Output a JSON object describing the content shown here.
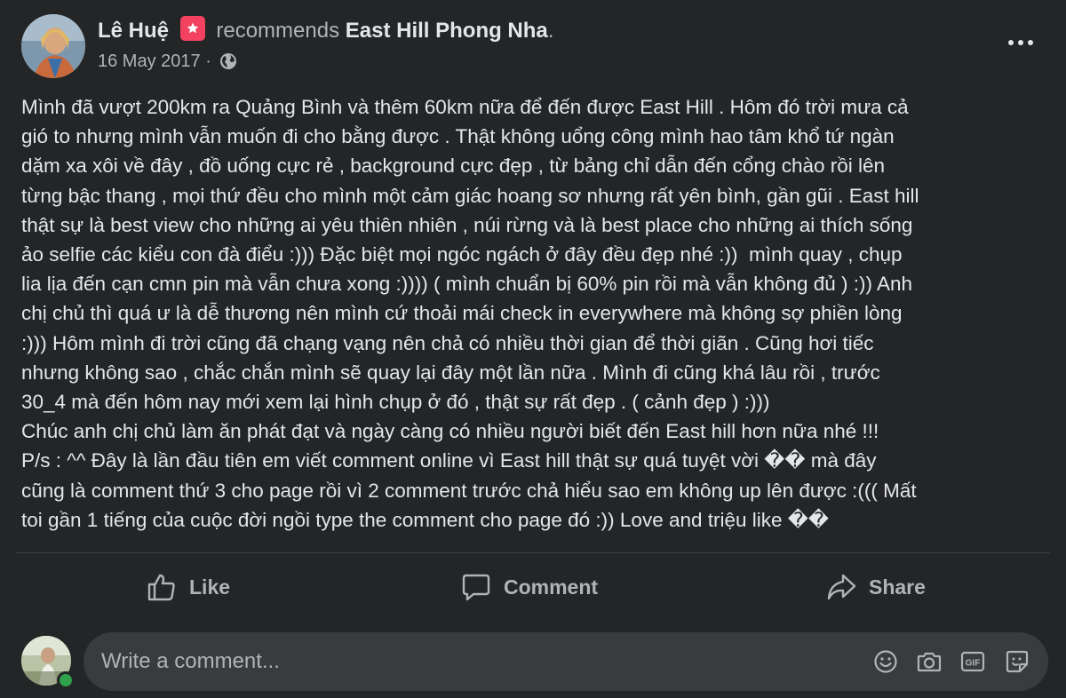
{
  "post": {
    "author": "Lê Huệ",
    "verb": "recommends",
    "page_name": "East Hill Phong Nha",
    "page_suffix": ".",
    "date": "16 May 2017",
    "date_separator": "·",
    "text": "Mình đã vượt 200km ra Quảng Bình và thêm 60km nữa để đến được East Hill . Hôm đó trời mưa cả\ngió to nhưng mình vẫn muốn đi cho bằng được . Thật không uổng công mình hao tâm khổ tứ ngàn\ndặm xa xôi về đây , đồ uống cực rẻ , background cực đẹp , từ bảng chỉ dẫn đến cổng chào rồi lên\ntừng bậc thang , mọi thứ đều cho mình một cảm giác hoang sơ nhưng rất yên bình, gần gũi . East hill\nthật sự là best view cho những ai yêu thiên nhiên , núi rừng và là best place cho những ai thích sống\nảo selfie các kiểu con đà điểu :))) Đặc biệt mọi ngóc ngách ở đây đều đẹp nhé :))  mình quay , chụp\nlia lịa đến cạn cmn pin mà vẫn chưa xong :)))) ( mình chuẩn bị 60% pin rồi mà vẫn không đủ ) :)) Anh\nchị chủ thì quá ư là dễ thương nên mình cứ thoải mái check in everywhere mà không sợ phiền lòng\n:))) Hôm mình đi trời cũng đã chạng vạng nên chả có nhiều thời gian để thời giãn . Cũng hơi tiếc\nnhưng không sao , chắc chắn mình sẽ quay lại đây một lần nữa . Mình đi cũng khá lâu rồi , trước\n30_4 mà đến hôm nay mới xem lại hình chụp ở đó , thật sự rất đẹp . ( cảnh đẹp ) :)))\nChúc anh chị chủ làm ăn phát đạt và ngày càng có nhiều người biết đến East hill hơn nữa nhé !!!\nP/s : ^^ Đây là lần đầu tiên em viết comment online vì East hill thật sự quá tuyệt vời �� mà đây\ncũng là comment thứ 3 cho page rồi vì 2 comment trước chả hiểu sao em không up lên được :((( Mất\ntoi gần 1 tiếng của cuộc đời ngồi type the comment cho page đó :)) Love and triệu like ��"
  },
  "actions": {
    "like": "Like",
    "comment": "Comment",
    "share": "Share"
  },
  "composer": {
    "placeholder": "Write a comment...",
    "icons": [
      "emoji-icon",
      "camera-icon",
      "gif-icon",
      "sticker-icon"
    ]
  },
  "colors": {
    "background": "#242526",
    "text_primary": "#e4e6eb",
    "text_secondary": "#b0b3b8",
    "recommend_badge": "#f3425f",
    "input_background": "#3a3b3c",
    "online": "#31a24c"
  }
}
